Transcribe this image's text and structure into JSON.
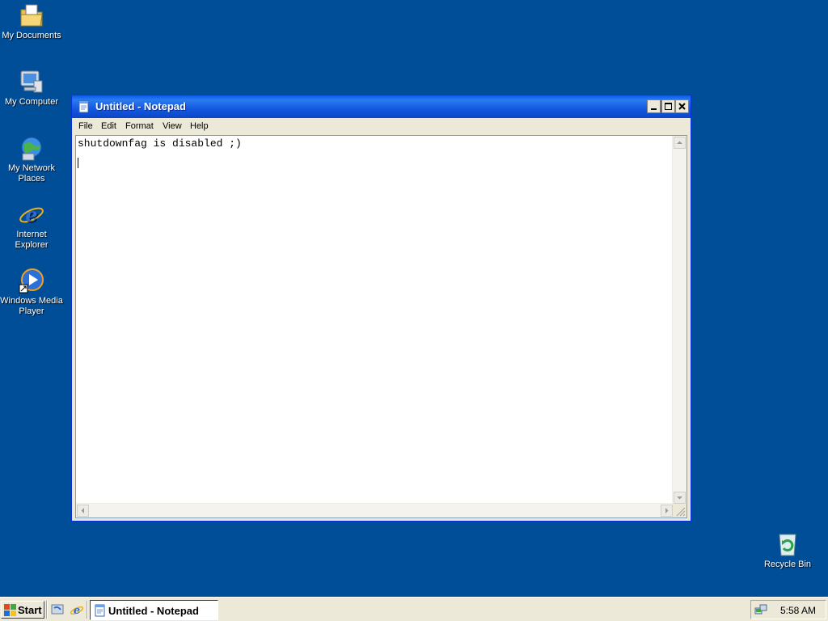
{
  "desktop": {
    "icons": [
      {
        "label": "My Documents"
      },
      {
        "label": "My Computer"
      },
      {
        "label_line1": "My Network",
        "label_line2": "Places"
      },
      {
        "label_line1": "Internet",
        "label_line2": "Explorer"
      },
      {
        "label_line1": "Windows Media",
        "label_line2": "Player"
      },
      {
        "label": "Recycle Bin"
      }
    ],
    "background_color": "#004e98"
  },
  "window": {
    "title": "Untitled - Notepad",
    "menu": [
      "File",
      "Edit",
      "Format",
      "View",
      "Help"
    ],
    "content_line1": "shutdownfag is disabled ;)"
  },
  "taskbar": {
    "start_label": "Start",
    "task_label": "Untitled - Notepad",
    "clock": "5:58 AM"
  }
}
